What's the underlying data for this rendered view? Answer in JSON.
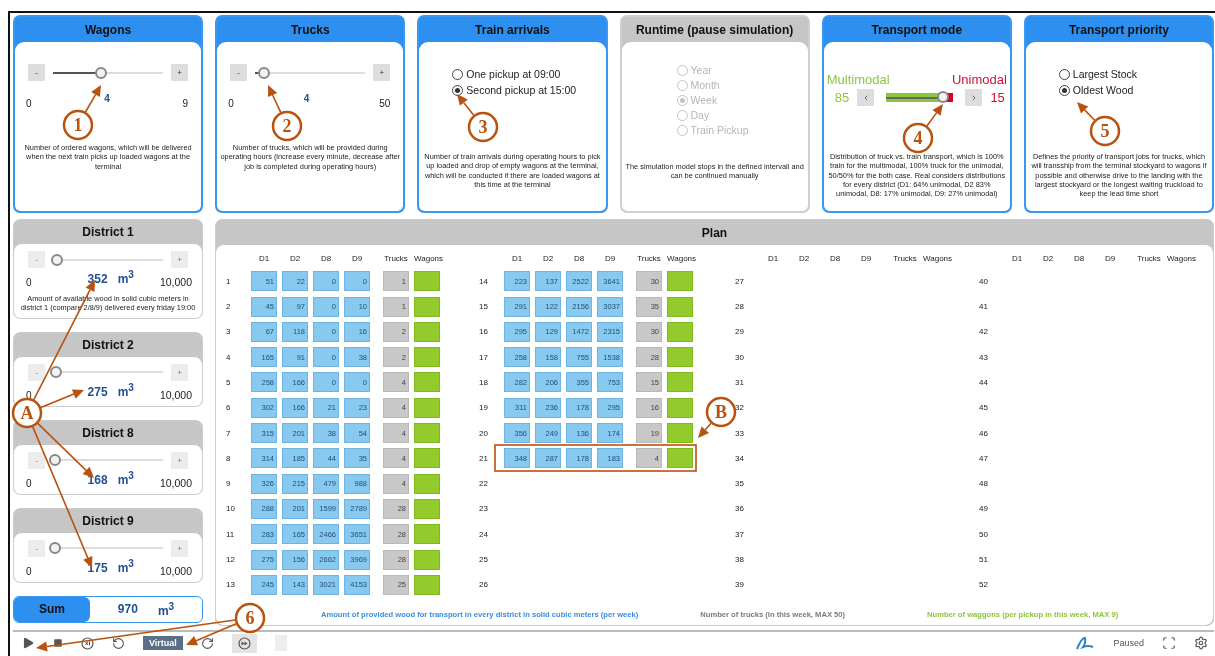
{
  "top_panels": [
    {
      "kind": "slider",
      "title": "Wagons",
      "enabled": true,
      "buttons": [
        "-",
        "+"
      ],
      "min": "0",
      "value": "4",
      "max": "9",
      "level": 0.44,
      "description": "Number of ordered wagons, which will be delivered when the next train picks up loaded wagons at the terminal"
    },
    {
      "kind": "slider",
      "title": "Trucks",
      "enabled": true,
      "buttons": [
        "-",
        "+"
      ],
      "min": "0",
      "value": "4",
      "max": "50",
      "level": 0.08,
      "description": "Number of trucks, which will be provided during operating hours (increase every minute, decrease after job is completed during operating hours)"
    },
    {
      "kind": "radio",
      "title": "Train arrivals",
      "enabled": true,
      "options": [
        {
          "label": "One pickup at 09:00",
          "selected": false
        },
        {
          "label": "Second pickup at 15:00",
          "selected": true
        }
      ],
      "description": "Number of train arrivals during operating hours to pick up loaded and drop of empty wagons at the terminal, which will be conducted if there are loaded wagons at this time at the terminal"
    },
    {
      "kind": "radio",
      "title": "Runtime (pause simulation)",
      "enabled": false,
      "options": [
        {
          "label": "Year",
          "selected": false
        },
        {
          "label": "Month",
          "selected": false
        },
        {
          "label": "Week",
          "selected": true
        },
        {
          "label": "Day",
          "selected": false
        },
        {
          "label": "Train Pickup",
          "selected": false
        }
      ],
      "description": "The simulation model stops in the defined intervall and can be continued manually"
    },
    {
      "kind": "mode",
      "title": "Transport mode",
      "enabled": true,
      "left_label": "Multimodal",
      "left_value": "85",
      "right_label": "Unimodal",
      "right_value": "15",
      "level": 0.85,
      "description": "Distribution of truck vs. train transport, which is 100% train for the multimodal, 100% truck for the unimodal, 50/50% for the both case. Real considers distributions for every district (D1: 64% unimodal, D2 83% unimodal, D8: 17% unimodal, D9: 27% unimodal)"
    },
    {
      "kind": "radio",
      "title": "Transport priority",
      "enabled": true,
      "options": [
        {
          "label": "Largest Stock",
          "selected": false
        },
        {
          "label": "Oldest Wood",
          "selected": true
        }
      ],
      "description": "Defines the priority of transport jobs for trucks, which will transship from the terminal stockyard to wagons if possible and otherwise drive to the landing with the largest stockyard or the longest waiting truckload to keep the lead time short"
    }
  ],
  "districts": [
    {
      "title": "District 1",
      "buttons": [
        "-",
        "+"
      ],
      "min": "0",
      "value": "352",
      "unit": "m$^{3}$",
      "max": "10,000",
      "level": 0.035,
      "description": "Amount of available wood in solid cubic meters in district 1 (compare 2/8/9) delivered every friday 19:00"
    },
    {
      "title": "District 2",
      "buttons": [
        "-",
        "+"
      ],
      "min": "0",
      "value": "275",
      "unit": "m$^{3}$",
      "max": "10,000",
      "level": 0.028
    },
    {
      "title": "District 8",
      "buttons": [
        "-",
        "+"
      ],
      "min": "0",
      "value": "168",
      "unit": "m$^{3}$",
      "max": "10,000",
      "level": 0.017
    },
    {
      "title": "District 9",
      "buttons": [
        "-",
        "+"
      ],
      "min": "0",
      "value": "175",
      "unit": "m$^{3}$",
      "max": "10,000",
      "level": 0.018
    }
  ],
  "sum": {
    "label": "Sum",
    "value": "970",
    "unit": "m$^{3}$"
  },
  "plan": {
    "title": "Plan",
    "groups": [
      {
        "columns": [
          "D1",
          "D2",
          "D8",
          "D9",
          "Trucks",
          "Wagons"
        ],
        "rows": [
          {
            "week": "1",
            "cells": [
              "51",
              "22",
              "0",
              "0",
              "1"
            ]
          },
          {
            "week": "2",
            "cells": [
              "45",
              "97",
              "0",
              "10",
              "1"
            ]
          },
          {
            "week": "3",
            "cells": [
              "67",
              "118",
              "0",
              "16",
              "2"
            ]
          },
          {
            "week": "4",
            "cells": [
              "165",
              "91",
              "0",
              "38",
              "2"
            ]
          },
          {
            "week": "5",
            "cells": [
              "258",
              "166",
              "0",
              "0",
              "4"
            ]
          },
          {
            "week": "6",
            "cells": [
              "302",
              "166",
              "21",
              "23",
              "4"
            ]
          },
          {
            "week": "7",
            "cells": [
              "315",
              "201",
              "38",
              "54",
              "4"
            ]
          },
          {
            "week": "8",
            "cells": [
              "314",
              "185",
              "44",
              "35",
              "4"
            ]
          },
          {
            "week": "9",
            "cells": [
              "326",
              "215",
              "479",
              "988",
              "4"
            ]
          },
          {
            "week": "10",
            "cells": [
              "288",
              "201",
              "1599",
              "2789",
              "28"
            ]
          },
          {
            "week": "11",
            "cells": [
              "283",
              "165",
              "2466",
              "3651",
              "28"
            ]
          },
          {
            "week": "12",
            "cells": [
              "275",
              "156",
              "2662",
              "3969",
              "28"
            ]
          },
          {
            "week": "13",
            "cells": [
              "245",
              "143",
              "3021",
              "4153",
              "25"
            ]
          }
        ]
      },
      {
        "columns": [
          "D1",
          "D2",
          "D8",
          "D9",
          "Trucks",
          "Wagons"
        ],
        "rows": [
          {
            "week": "14",
            "cells": [
              "223",
              "137",
              "2522",
              "3641",
              "30"
            ]
          },
          {
            "week": "15",
            "cells": [
              "291",
              "122",
              "2156",
              "3037",
              "35"
            ]
          },
          {
            "week": "16",
            "cells": [
              "295",
              "129",
              "1472",
              "2315",
              "30"
            ]
          },
          {
            "week": "17",
            "cells": [
              "258",
              "158",
              "755",
              "1538",
              "28"
            ]
          },
          {
            "week": "18",
            "cells": [
              "282",
              "206",
              "355",
              "753",
              "15"
            ]
          },
          {
            "week": "19",
            "cells": [
              "311",
              "236",
              "178",
              "295",
              "16"
            ]
          },
          {
            "week": "20",
            "cells": [
              "356",
              "249",
              "136",
              "174",
              "19"
            ]
          },
          {
            "week": "21",
            "cells": [
              "348",
              "287",
              "178",
              "183",
              "4"
            ]
          },
          {
            "week": "22"
          },
          {
            "week": "23"
          },
          {
            "week": "24"
          },
          {
            "week": "25"
          },
          {
            "week": "26"
          }
        ]
      },
      {
        "columns": [
          "D1",
          "D2",
          "D8",
          "D9",
          "Trucks",
          "Wagons"
        ],
        "rows": [
          {
            "week": "27"
          },
          {
            "week": "28"
          },
          {
            "week": "29"
          },
          {
            "week": "30"
          },
          {
            "week": "31"
          },
          {
            "week": "32"
          },
          {
            "week": "33"
          },
          {
            "week": "34"
          },
          {
            "week": "35"
          },
          {
            "week": "36"
          },
          {
            "week": "37"
          },
          {
            "week": "38"
          },
          {
            "week": "39"
          }
        ]
      },
      {
        "columns": [
          "D1",
          "D2",
          "D8",
          "D9",
          "Trucks",
          "Wagons"
        ],
        "rows": [
          {
            "week": "40"
          },
          {
            "week": "41"
          },
          {
            "week": "42"
          },
          {
            "week": "43"
          },
          {
            "week": "44"
          },
          {
            "week": "45"
          },
          {
            "week": "46"
          },
          {
            "week": "47"
          },
          {
            "week": "48"
          },
          {
            "week": "49"
          },
          {
            "week": "50"
          },
          {
            "week": "51"
          },
          {
            "week": "52"
          }
        ]
      }
    ],
    "legend": [
      {
        "text": "Amount of provided wood for transport in every district in solid cubic meters (per week)",
        "color": "#3a8ee0"
      },
      {
        "text": "Number of trucks (in this week, MAX 50)",
        "color": "#7a7a7a"
      },
      {
        "text": "Number of waggons (per pickup in this week, MAX 9)",
        "color": "#8cc63f"
      }
    ]
  },
  "toolbar": {
    "time_mode": "Virtual",
    "status": "Paused"
  },
  "annotations": [
    {
      "label": "1"
    },
    {
      "label": "2"
    },
    {
      "label": "3"
    },
    {
      "label": "4"
    },
    {
      "label": "5"
    },
    {
      "label": "6"
    },
    {
      "label": "A"
    },
    {
      "label": "B"
    }
  ]
}
